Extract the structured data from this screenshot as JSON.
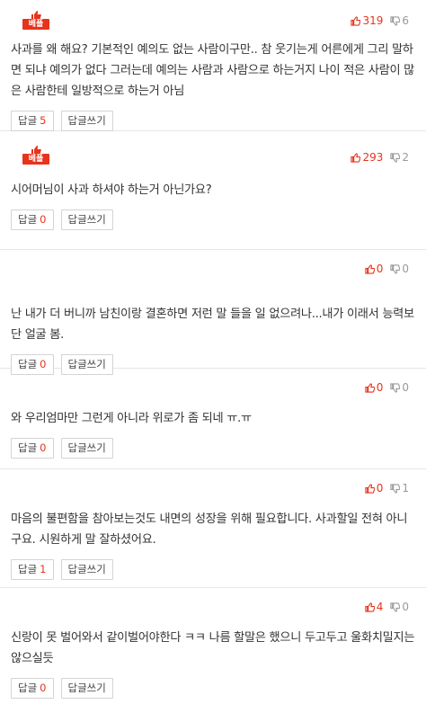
{
  "best_badge_label": "베플",
  "reply_label": "답글",
  "write_reply_label": "답글쓰기",
  "colors": {
    "accent": "#e7331b",
    "muted": "#999999",
    "border": "#d4d4d4"
  },
  "icons": {
    "up": "thumbs-up-icon",
    "down": "thumbs-down-icon",
    "best": "thumbs-up-trophy-icon"
  },
  "comments": [
    {
      "best": true,
      "up": "319",
      "down": "6",
      "text": "사과를 왜 해요? 기본적인 예의도 없는 사람이구만.. 참 웃기는게 어른에게 그리 말하면 되냐 예의가 없다 그러는데 예의는 사람과 사람으로 하는거지 나이 적은 사람이 많은 사람한테 일방적으로 하는거 아님",
      "reply_count": "5"
    },
    {
      "best": true,
      "up": "293",
      "down": "2",
      "text": "시어머님이 사과 하셔야 하는거 아닌가요?",
      "reply_count": "0"
    },
    {
      "best": false,
      "up": "0",
      "down": "0",
      "text": "난 내가 더 버니까 남친이랑 결혼하면 저런 말 들을 일 없으려나...내가 이래서 능력보단 얼굴 봄.",
      "reply_count": "0"
    },
    {
      "best": false,
      "up": "0",
      "down": "0",
      "text": "와 우리엄마만 그런게 아니라 위로가 좀 되네 ㅠ.ㅠ",
      "reply_count": "0"
    },
    {
      "best": false,
      "up": "0",
      "down": "1",
      "text": "마음의 불편함을 참아보는것도 내면의 성장을 위해 필요합니다. 사과할일 전혀 아니구요. 시원하게 말 잘하셨어요.",
      "reply_count": "1"
    },
    {
      "best": false,
      "up": "4",
      "down": "0",
      "text": "신랑이 못 벌어와서 같이벌어야한다 ㅋㅋ 나름 할말은 했으니 두고두고 울화치밀지는 않으실듯",
      "reply_count": "0"
    }
  ]
}
